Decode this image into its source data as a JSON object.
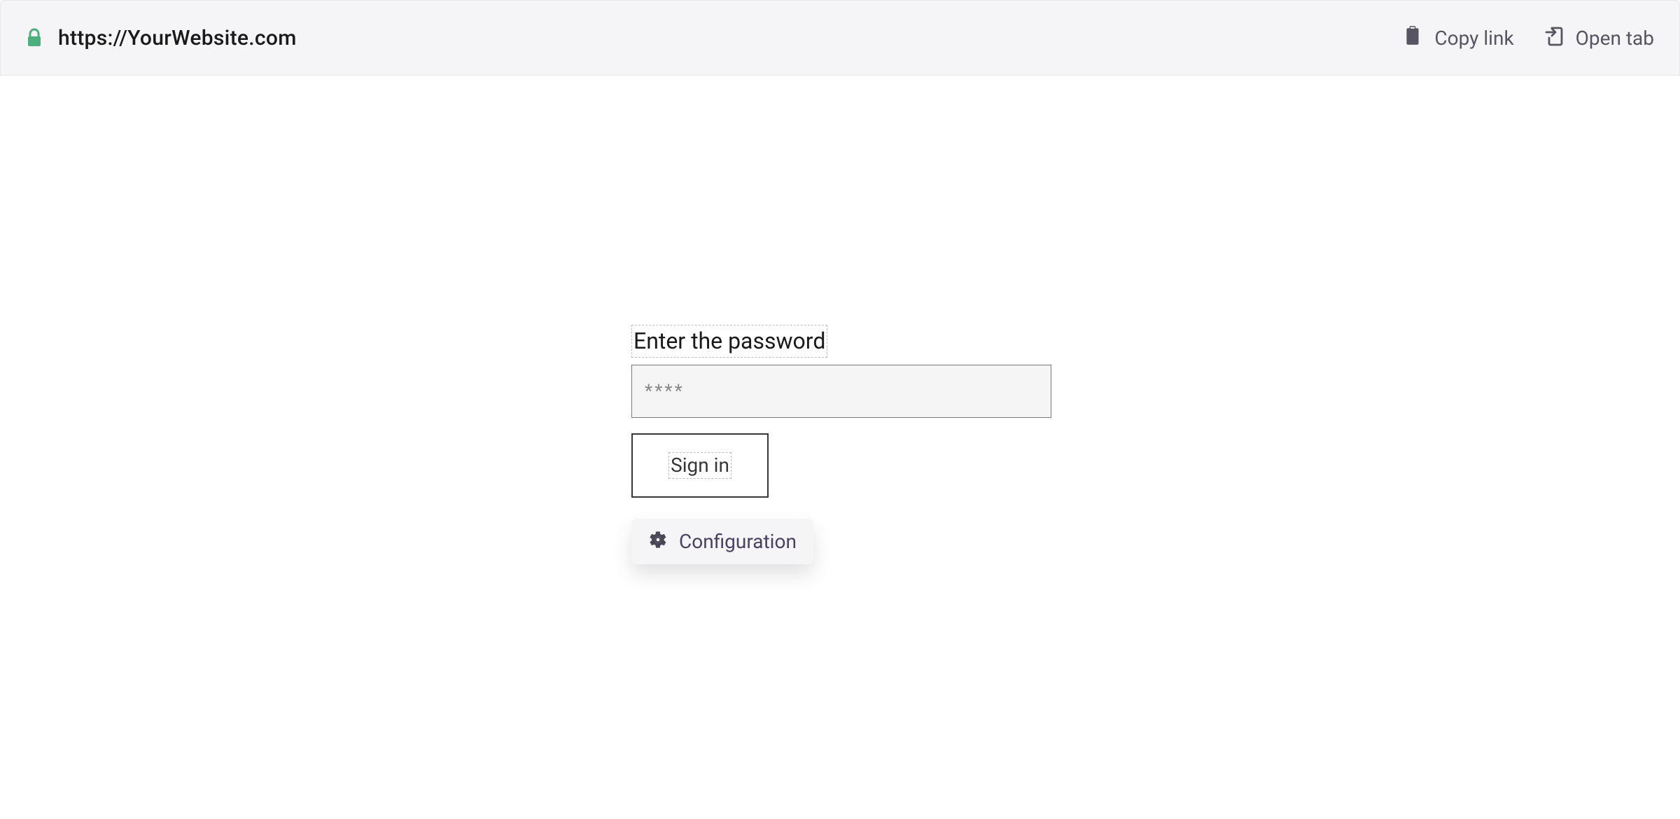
{
  "browser": {
    "url": "https://YourWebsite.com",
    "copy_link_label": "Copy link",
    "open_tab_label": "Open tab"
  },
  "form": {
    "password_label": "Enter the password",
    "password_placeholder": "****",
    "signin_label": "Sign in",
    "config_label": "Configuration"
  }
}
